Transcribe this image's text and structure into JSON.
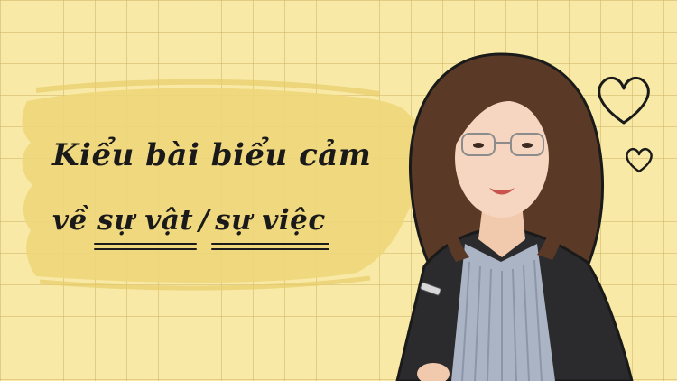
{
  "thumbnail": {
    "title_line1": "Kiểu bài biểu cảm",
    "title_line2_prefix": "về ",
    "highlight_1": "sự vật",
    "separator": "/",
    "highlight_2": "sự việc"
  },
  "colors": {
    "background": "#f8eaa6",
    "grid": "#d8c27a",
    "brush_stroke": "#eed67a",
    "text": "#1a1a1a"
  },
  "icons": [
    "heart-outline-icon",
    "heart-outline-icon"
  ]
}
